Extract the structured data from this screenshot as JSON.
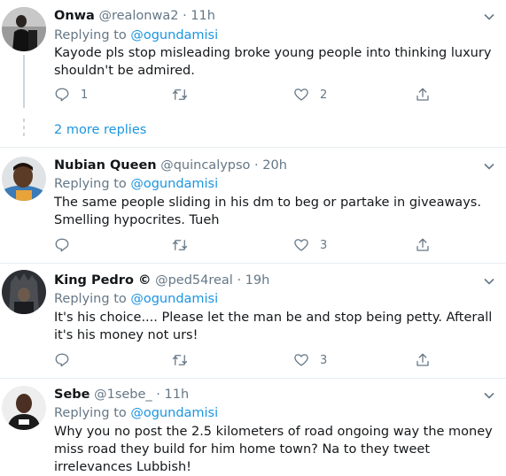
{
  "tweets": [
    {
      "name": "Onwa",
      "handle": "@realonwa2",
      "time": "11h",
      "replying_label": "Replying to",
      "replying_to": "@ogundamisi",
      "text": "Kayode pls stop misleading broke young people into thinking luxury shouldn't be admired.",
      "replies": "1",
      "retweets": "",
      "likes": "2"
    },
    {
      "name": "Nubian Queen",
      "handle": "@quincalypso",
      "time": "20h",
      "replying_label": "Replying to",
      "replying_to": "@ogundamisi",
      "text": "The same people sliding in his dm to beg or partake in giveaways. Smelling hypocrites. Tueh",
      "replies": "",
      "retweets": "",
      "likes": "3"
    },
    {
      "name": "King Pedro ©",
      "handle": "@ped54real",
      "time": "19h",
      "replying_label": "Replying to",
      "replying_to": "@ogundamisi",
      "text": "It's his choice.... Please let the man be and stop being petty. Afterall it's his money not urs!",
      "replies": "",
      "retweets": "",
      "likes": "3"
    },
    {
      "name": "Sebe",
      "handle": "@1sebe_",
      "time": "11h",
      "replying_label": "Replying to",
      "replying_to": "@ogundamisi",
      "text": "Why you no post the 2.5 kilometers of road ongoing way the money miss road they build for him home town? Na to they tweet irrelevances Lubbish!"
    }
  ],
  "more_replies": "2 more replies",
  "colors": {
    "accent": "#1b95e0",
    "secondary_text": "#657786",
    "divider": "#e6ecf0"
  },
  "icons": [
    "reply-icon",
    "retweet-icon",
    "like-icon",
    "share-icon",
    "caret-down-icon"
  ]
}
